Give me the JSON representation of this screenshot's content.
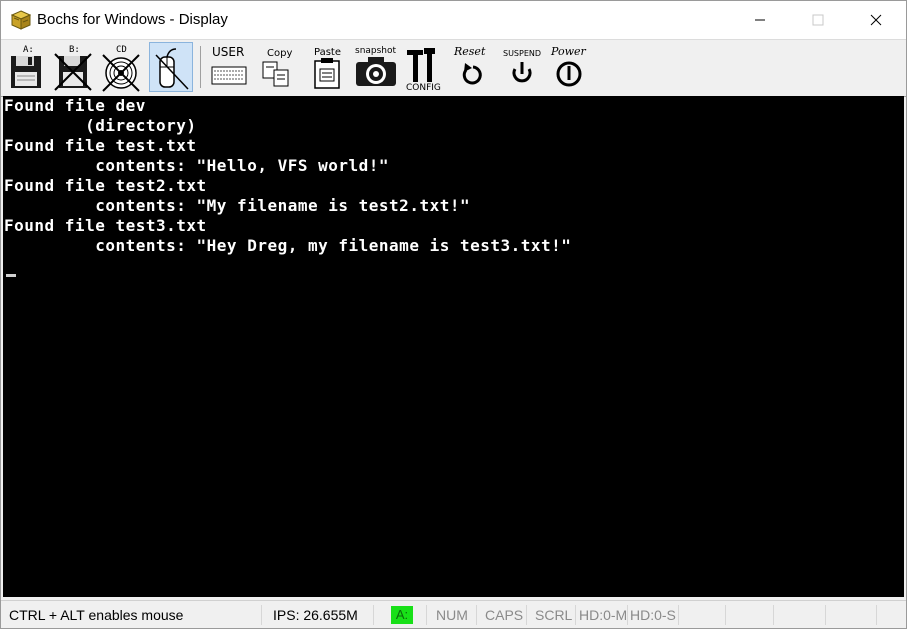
{
  "window": {
    "title": "Bochs for Windows - Display"
  },
  "toolbar": {
    "buttons": [
      {
        "label": "A:",
        "icon": "floppy-a-icon"
      },
      {
        "label": "B:",
        "icon": "floppy-b-disabled-icon"
      },
      {
        "label": "CD",
        "icon": "cdrom-disabled-icon"
      },
      {
        "label": "",
        "icon": "mouse-capture-icon"
      },
      {
        "label": "USER",
        "icon": "user-keyboard-icon"
      },
      {
        "label": "Copy",
        "icon": "copy-icon"
      },
      {
        "label": "Paste",
        "icon": "paste-icon"
      },
      {
        "label": "snapshot",
        "icon": "camera-icon"
      },
      {
        "label": "CONFIG",
        "icon": "config-tools-icon"
      },
      {
        "label": "Reset",
        "icon": "reset-icon"
      },
      {
        "label": "SUSPEND",
        "icon": "suspend-icon"
      },
      {
        "label": "Power",
        "icon": "power-icon"
      }
    ]
  },
  "console": {
    "lines": [
      "Found file dev",
      "        (directory)",
      "Found file test.txt",
      "         contents: \"Hello, VFS world!\"",
      "Found file test2.txt",
      "         contents: \"My filename is test2.txt!\"",
      "Found file test3.txt",
      "         contents: \"Hey Dreg, my filename is test3.txt!\""
    ]
  },
  "status": {
    "mouse_hint": "CTRL + ALT enables mouse",
    "ips": "IPS: 26.655M",
    "drive": "A:",
    "num": "NUM",
    "caps": "CAPS",
    "scrl": "SCRL",
    "hd0m": "HD:0-M",
    "hd0s": "HD:0-S"
  },
  "colors": {
    "console_bg": "#000000",
    "console_fg": "#ffffff",
    "drive_led": "#18e018",
    "pressed_button": "#cfe3f7"
  }
}
